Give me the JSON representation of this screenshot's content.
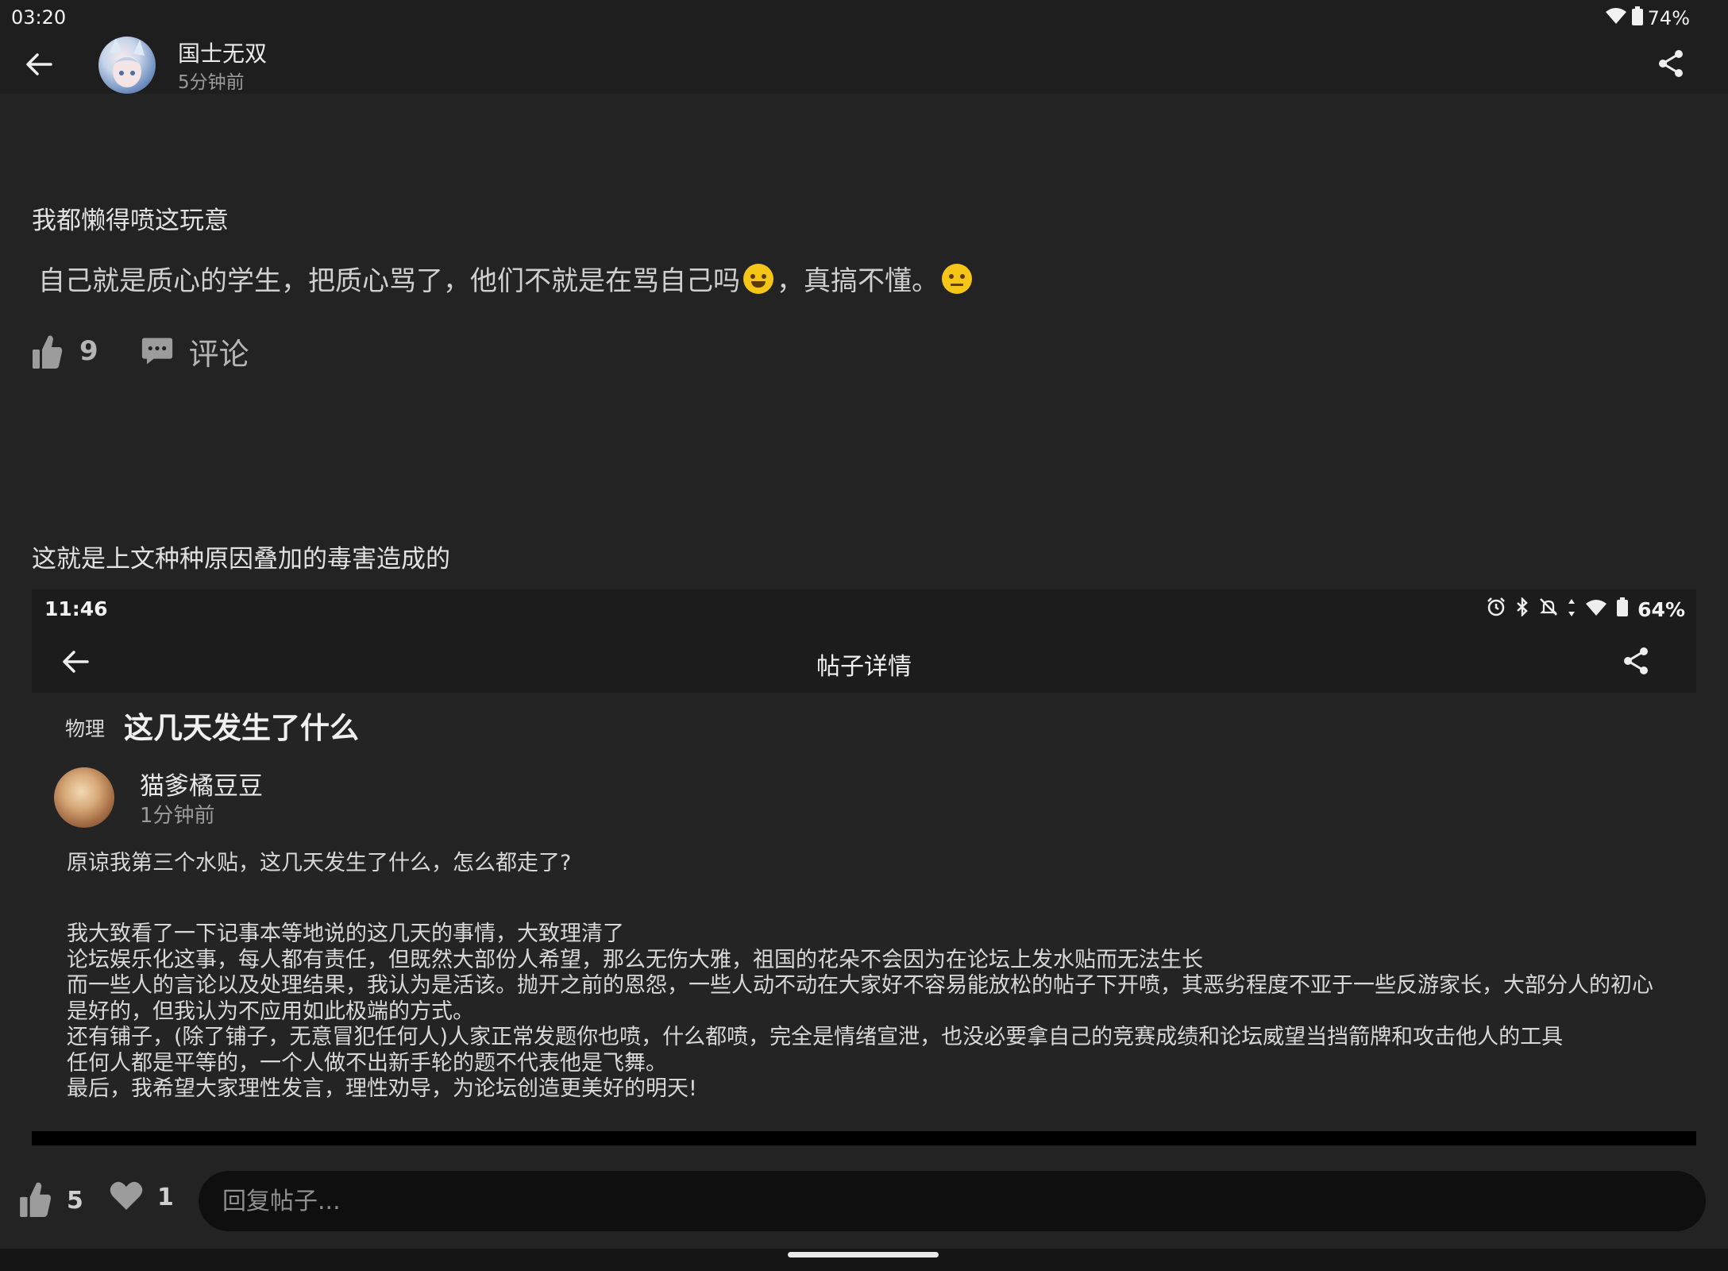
{
  "status_bar": {
    "time": "03:20",
    "battery": "74%"
  },
  "header": {
    "author_name": "国士无双",
    "author_time": "5分钟前"
  },
  "post": {
    "line1": "我都懒得喷这玩意",
    "line2_part1": "自己就是质心的学生，把质心骂了，他们不就是在骂自己吗",
    "line2_part2": "，真搞不懂。",
    "likes": "9",
    "comment_label": "评论",
    "line3": "这就是上文种种原因叠加的毒害造成的"
  },
  "embed": {
    "status_time": "11:46",
    "battery": "64%",
    "title": "帖子详情",
    "tag": "物理",
    "thread_title": "这几天发生了什么",
    "author_name": "猫爹橘豆豆",
    "author_time": "1分钟前",
    "intro": "原谅我第三个水贴，这几天发生了什么，怎么都走了?",
    "body": [
      "我大致看了一下记事本等地说的这几天的事情，大致理清了",
      "论坛娱乐化这事，每人都有责任，但既然大部份人希望，那么无伤大雅，祖国的花朵不会因为在论坛上发水贴而无法生长",
      "而一些人的言论以及处理结果，我认为是活该。抛开之前的恩怨，一些人动不动在大家好不容易能放松的帖子下开喷，其恶劣程度不亚于一些反游家长，大部分人的初心是好的，但我认为不应用如此极端的方式。",
      "还有铺子，(除了铺子，无意冒犯任何人)人家正常发题你也喷，什么都喷，完全是情绪宣泄，也没必要拿自己的竞赛成绩和论坛威望当挡箭牌和攻击他人的工具",
      "任何人都是平等的，一个人做不出新手轮的题不代表他是飞舞。",
      "最后，我希望大家理性发言，理性劝导，为论坛创造更美好的明天!"
    ]
  },
  "bottom": {
    "likes": "5",
    "hearts": "1",
    "reply_placeholder": "回复帖子..."
  },
  "icons": [
    "back-arrow-icon",
    "share-icon",
    "wifi-icon",
    "battery-icon",
    "thumb-up-icon",
    "comment-icon",
    "heart-icon",
    "alarm-icon",
    "bluetooth-icon",
    "bell-off-icon",
    "data-arrows-icon"
  ]
}
